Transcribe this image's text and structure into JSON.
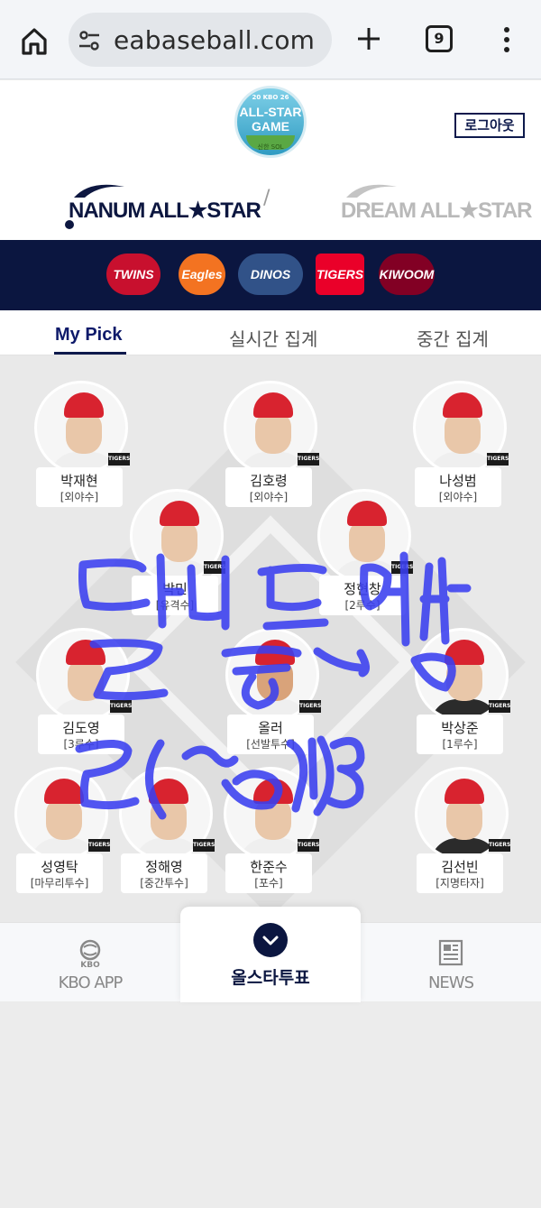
{
  "browser": {
    "url": "eabaseball.com",
    "tab_count": "9"
  },
  "header": {
    "badge_line1": "20 KBO 26",
    "badge_line2": "ALL-STAR",
    "badge_line3": "GAME",
    "badge_line4": "신한 SOL",
    "logout_label": "로그아웃",
    "team_left": "NANUM ALL★STAR",
    "separator": "/",
    "team_right": "DREAM ALL★STAR"
  },
  "teams": [
    {
      "name": "TWINS",
      "color": "#c8102e"
    },
    {
      "name": "Eagles",
      "color": "#f37321"
    },
    {
      "name": "DINOS",
      "color": "#315288"
    },
    {
      "name": "TIGERS",
      "color": "#ea0029"
    },
    {
      "name": "KIWOOM",
      "color": "#820024"
    }
  ],
  "tabs": [
    {
      "label": "My Pick",
      "active": true
    },
    {
      "label": "실시간 집계",
      "active": false
    },
    {
      "label": "중간 집계",
      "active": false
    }
  ],
  "team_tag": "TIGERS",
  "players": [
    {
      "name": "박재현",
      "position": "[외야수]"
    },
    {
      "name": "김호령",
      "position": "[외야수]"
    },
    {
      "name": "나성범",
      "position": "[외야수]"
    },
    {
      "name": "박민",
      "position": "[유격수]"
    },
    {
      "name": "정현창",
      "position": "[2루수]"
    },
    {
      "name": "김도영",
      "position": "[3루수]"
    },
    {
      "name": "올러",
      "position": "[선발투수]"
    },
    {
      "name": "박상준",
      "position": "[1루수]"
    },
    {
      "name": "성영탁",
      "position": "[마무리투수]"
    },
    {
      "name": "정해영",
      "position": "[중간투수]"
    },
    {
      "name": "한준수",
      "position": "[포수]"
    },
    {
      "name": "김선빈",
      "position": "[지명타자]"
    }
  ],
  "bottom_nav": {
    "kbo_small": "KBO",
    "kbo_app": "KBO APP",
    "vote": "올스타투표",
    "news": "NEWS"
  },
  "colors": {
    "navy": "#0b1640",
    "scribble": "#3a3ff0"
  }
}
